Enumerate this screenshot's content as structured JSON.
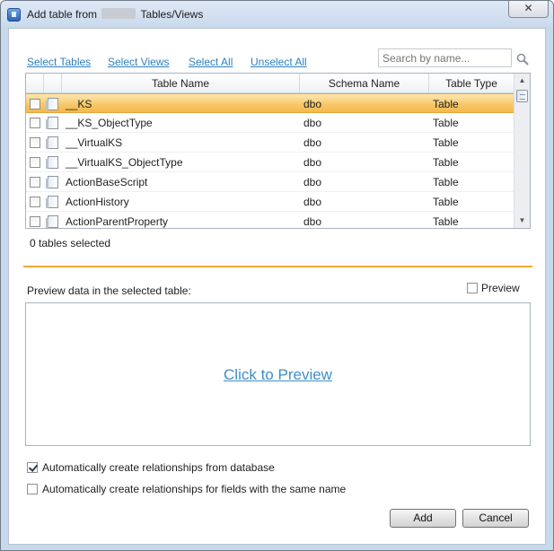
{
  "window": {
    "title_prefix": "Add table from",
    "title_suffix": "Tables/Views",
    "close_label": "✕"
  },
  "toolbar": {
    "select_tables": "Select Tables",
    "select_views": "Select Views",
    "select_all": "Select All",
    "unselect_all": "Unselect All",
    "search_placeholder": "Search by name..."
  },
  "grid": {
    "columns": [
      "Table Name",
      "Schema Name",
      "Table Type"
    ],
    "rows": [
      {
        "name": "__KS",
        "schema": "dbo",
        "type": "Table",
        "selected": true
      },
      {
        "name": "__KS_ObjectType",
        "schema": "dbo",
        "type": "Table"
      },
      {
        "name": "__VirtualKS",
        "schema": "dbo",
        "type": "Table"
      },
      {
        "name": "__VirtualKS_ObjectType",
        "schema": "dbo",
        "type": "Table"
      },
      {
        "name": "ActionBaseScript",
        "schema": "dbo",
        "type": "Table"
      },
      {
        "name": "ActionHistory",
        "schema": "dbo",
        "type": "Table"
      },
      {
        "name": "ActionParentProperty",
        "schema": "dbo",
        "type": "Table"
      }
    ]
  },
  "status": {
    "selected_count": "0 tables selected"
  },
  "preview": {
    "label": "Preview data in the selected table:",
    "checkbox_label": "Preview",
    "click_label": "Click to Preview"
  },
  "options": {
    "auto_relationships_db": "Automatically create relationships from database",
    "auto_relationships_db_checked": true,
    "auto_relationships_names": "Automatically create relationships for fields with the same name",
    "auto_relationships_names_checked": false
  },
  "buttons": {
    "add": "Add",
    "cancel": "Cancel"
  },
  "colors": {
    "selected_row": "#f7c765",
    "link": "#2f7fbf",
    "divider": "#f2a838"
  }
}
